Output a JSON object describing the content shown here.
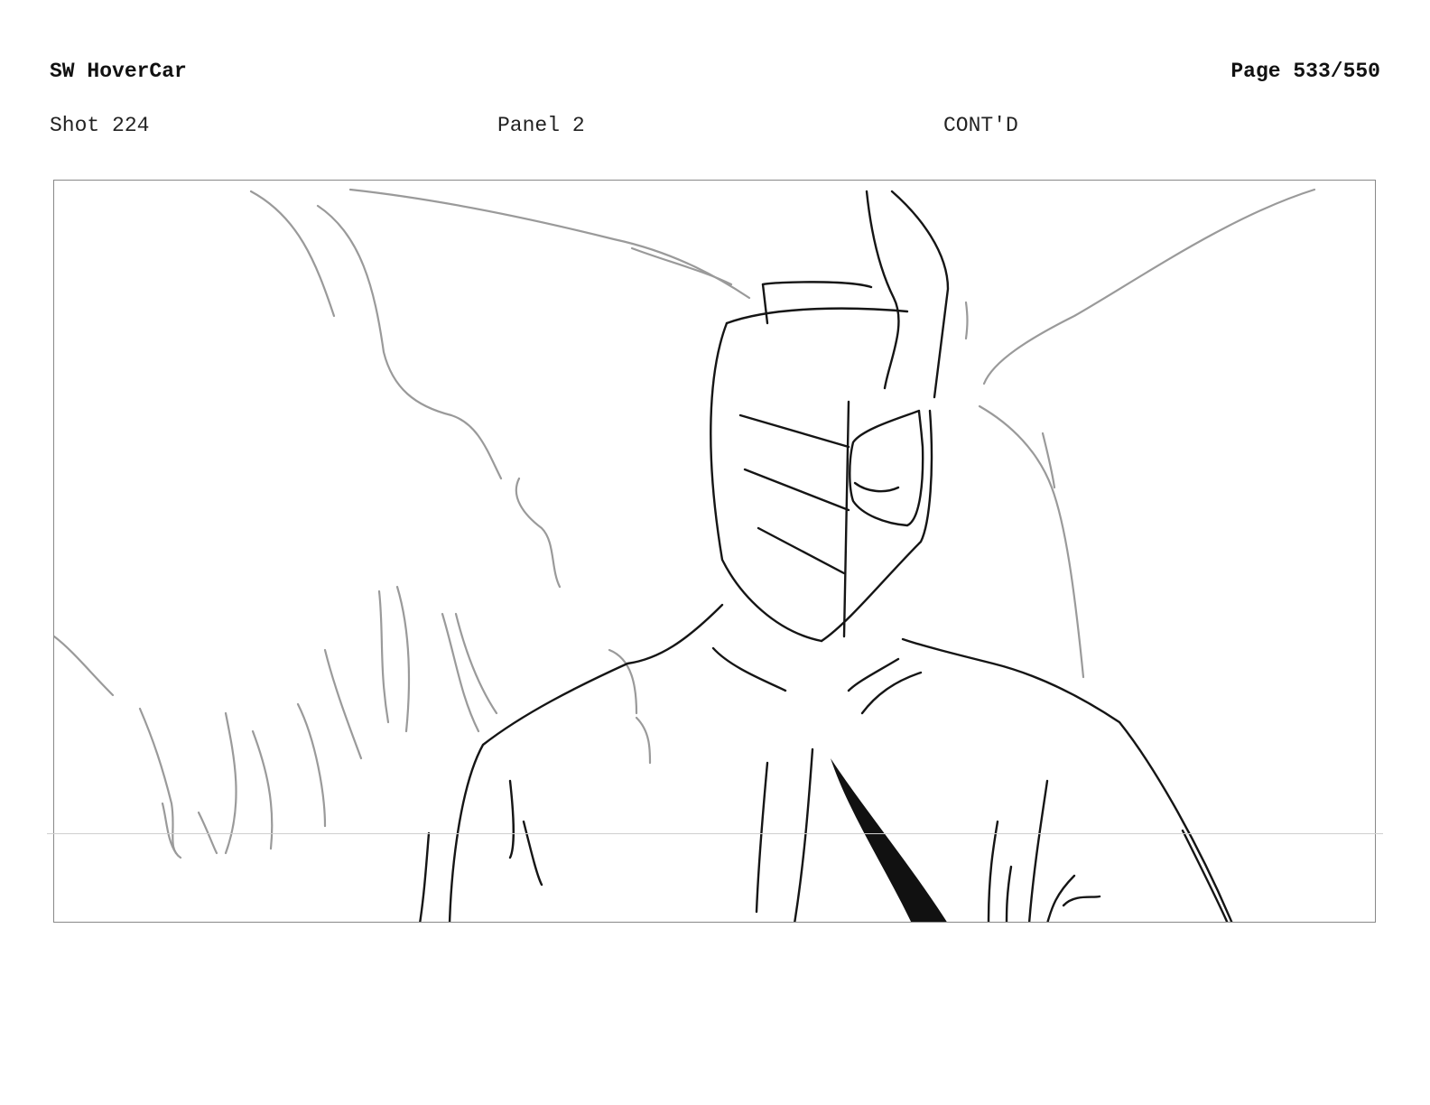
{
  "header": {
    "project_title": "SW HoverCar",
    "page_number": "Page 533/550"
  },
  "shot_info": {
    "shot": "Shot 224",
    "panel": "Panel 2",
    "continuation": "CONT'D"
  },
  "panel_frame": {
    "content": "storyboard-sketch",
    "border_color": "#888888",
    "line_color": "#111111",
    "sketch_gray": "#9a9a9a"
  }
}
